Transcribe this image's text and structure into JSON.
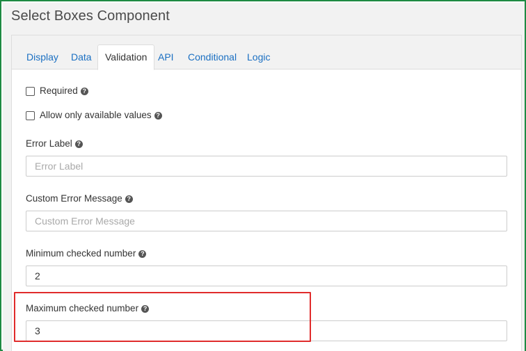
{
  "dialog": {
    "title": "Select Boxes Component"
  },
  "tabs": [
    {
      "label": "Display"
    },
    {
      "label": "Data"
    },
    {
      "label": "Validation"
    },
    {
      "label": "API"
    },
    {
      "label": "Conditional"
    },
    {
      "label": "Logic"
    }
  ],
  "active_tab": "Validation",
  "validation": {
    "required_label": "Required",
    "required_checked": false,
    "only_available_label": "Allow only available values",
    "only_available_checked": false,
    "error_label": {
      "label": "Error Label",
      "placeholder": "Error Label",
      "value": ""
    },
    "custom_error": {
      "label": "Custom Error Message",
      "placeholder": "Custom Error Message",
      "value": ""
    },
    "min_checked": {
      "label": "Minimum checked number",
      "value": "2"
    },
    "max_checked": {
      "label": "Maximum checked number",
      "value": "3"
    }
  },
  "help_icon_glyph": "?",
  "colors": {
    "frame_border": "#1e8a43",
    "tab_link": "#1a6fc2",
    "highlight": "#e02b2b"
  }
}
